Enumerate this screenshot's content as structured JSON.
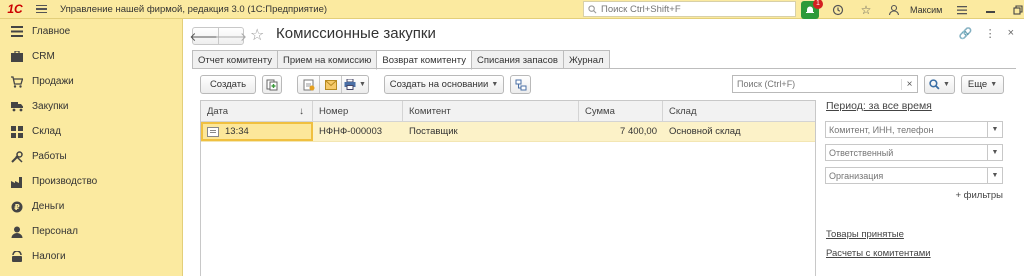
{
  "app": {
    "logo": "1С",
    "title": "Управление нашей фирмой, редакция 3.0  (1С:Предприятие)",
    "search_placeholder": "Поиск Ctrl+Shift+F",
    "notification_count": "1",
    "user_name": "Максим"
  },
  "sidebar": {
    "items": [
      {
        "label": "Главное",
        "icon": "menu-icon"
      },
      {
        "label": "CRM",
        "icon": "crm-icon"
      },
      {
        "label": "Продажи",
        "icon": "cart-icon"
      },
      {
        "label": "Закупки",
        "icon": "truck-icon"
      },
      {
        "label": "Склад",
        "icon": "warehouse-icon"
      },
      {
        "label": "Работы",
        "icon": "tools-icon"
      },
      {
        "label": "Производство",
        "icon": "factory-icon"
      },
      {
        "label": "Деньги",
        "icon": "money-icon"
      },
      {
        "label": "Персонал",
        "icon": "person-icon"
      },
      {
        "label": "Налоги",
        "icon": "taxes-icon"
      }
    ]
  },
  "page": {
    "title": "Комиссионные закупки",
    "tabs": [
      {
        "label": "Отчет комитенту",
        "active": false
      },
      {
        "label": "Прием на комиссию",
        "active": false
      },
      {
        "label": "Возврат комитенту",
        "active": true
      },
      {
        "label": "Списания запасов",
        "active": false
      },
      {
        "label": "Журнал",
        "active": false
      }
    ]
  },
  "toolbar": {
    "create_label": "Создать",
    "create_based_label": "Создать на основании",
    "search_placeholder": "Поиск (Ctrl+F)",
    "search_clear": "×",
    "more_label": "Еще"
  },
  "table": {
    "columns": [
      "Дата",
      "Номер",
      "Комитент",
      "Сумма",
      "Склад"
    ],
    "rows": [
      {
        "date": "13:34",
        "number": "НФНФ-000003",
        "committent": "Поставщик",
        "sum": "7 400,00",
        "warehouse": "Основной склад"
      }
    ]
  },
  "filters": {
    "period_label": "Период: за все время",
    "committent_placeholder": "Комитент, ИНН, телефон",
    "responsible_placeholder": "Ответственный",
    "organization_placeholder": "Организация",
    "more_filters_label": "+ фильтры",
    "links": [
      "Товары принятые",
      "Расчеты с комитентами"
    ]
  }
}
